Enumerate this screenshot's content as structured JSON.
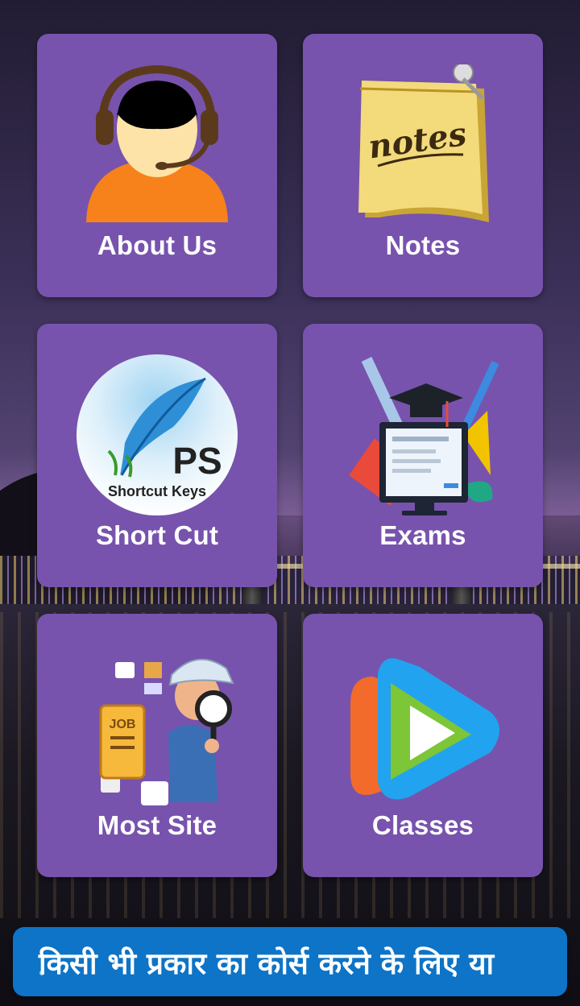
{
  "tiles": [
    {
      "label": "About Us",
      "icon": "support-agent-icon"
    },
    {
      "label": "Notes",
      "icon": "notes-pad-icon"
    },
    {
      "label": "Short Cut",
      "icon": "shortcut-keys-icon",
      "icon_text_main": "PS",
      "icon_text_sub": "Shortcut Keys"
    },
    {
      "label": "Exams",
      "icon": "exam-monitor-icon"
    },
    {
      "label": "Most Site",
      "icon": "job-search-detective-icon",
      "icon_text": "JOB"
    },
    {
      "label": "Classes",
      "icon": "video-play-icon"
    }
  ],
  "notes_icon_text": "notes",
  "ticker": {
    "text": "किसी भी प्रकार का कोर्स करने के लिए या"
  },
  "colors": {
    "tile": "#7753ad",
    "ticker": "#0d74c7",
    "text": "#ffffff"
  }
}
